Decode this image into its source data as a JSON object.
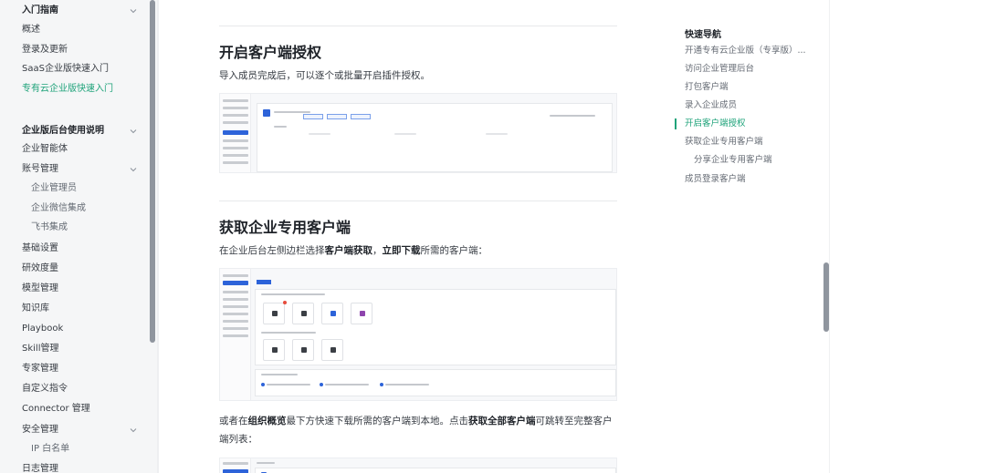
{
  "sidebar": {
    "items": [
      {
        "label": "入门指南",
        "kind": "group",
        "expanded": true
      },
      {
        "label": "概述",
        "kind": "item"
      },
      {
        "label": "登录及更新",
        "kind": "item"
      },
      {
        "label": "SaaS企业版快速入门",
        "kind": "item"
      },
      {
        "label": "专有云企业版快速入门",
        "kind": "item",
        "active": true
      },
      {
        "label": "企业版后台使用说明",
        "kind": "group",
        "expanded": true
      },
      {
        "label": "企业智能体",
        "kind": "item"
      },
      {
        "label": "账号管理",
        "kind": "item",
        "expanded": true
      },
      {
        "label": "企业管理员",
        "kind": "sub"
      },
      {
        "label": "企业微信集成",
        "kind": "sub"
      },
      {
        "label": "飞书集成",
        "kind": "sub"
      },
      {
        "label": "基础设置",
        "kind": "item"
      },
      {
        "label": "研效度量",
        "kind": "item"
      },
      {
        "label": "模型管理",
        "kind": "item"
      },
      {
        "label": "知识库",
        "kind": "item"
      },
      {
        "label": "Playbook",
        "kind": "item"
      },
      {
        "label": "Skill管理",
        "kind": "item"
      },
      {
        "label": "专家管理",
        "kind": "item"
      },
      {
        "label": "自定义指令",
        "kind": "item"
      },
      {
        "label": "Connector 管理",
        "kind": "item"
      },
      {
        "label": "安全管理",
        "kind": "item",
        "expanded": true
      },
      {
        "label": "IP 白名单",
        "kind": "sub"
      },
      {
        "label": "日志管理",
        "kind": "item"
      }
    ]
  },
  "content": {
    "section1": {
      "heading": "开启客户端授权",
      "text": "导入成员完成后，可以逐个或批量开启插件授权。"
    },
    "section2": {
      "heading": "获取企业专用客户端",
      "p1_a": "在企业后台左侧边栏选择",
      "p1_b1": "客户端获取",
      "p1_sep": "，",
      "p1_b2": "立即下载",
      "p1_c": "所需的客户端：",
      "p2_a": "或者在",
      "p2_b1": "组织概览",
      "p2_c": "最下方快速下载所需的客户端到本地。点击",
      "p2_b2": "获取全部客户端",
      "p2_d": "可跳转至完整客户端列表："
    }
  },
  "toc": {
    "title": "快速导航",
    "items": [
      {
        "label": "开通专有云企业版（专享版）...",
        "level": 1
      },
      {
        "label": "访问企业管理后台",
        "level": 1
      },
      {
        "label": "打包客户端",
        "level": 1
      },
      {
        "label": "录入企业成员",
        "level": 1
      },
      {
        "label": "开启客户端授权",
        "level": 1,
        "active": true
      },
      {
        "label": "获取企业专用客户端",
        "level": 1
      },
      {
        "label": "分享企业专用客户端",
        "level": 2
      },
      {
        "label": "成员登录客户端",
        "level": 1
      }
    ]
  },
  "colors": {
    "accent": "#1fa37a",
    "text": "#1f2329",
    "muted": "#646a73",
    "sidebar_bg": "#f5f6f7"
  }
}
